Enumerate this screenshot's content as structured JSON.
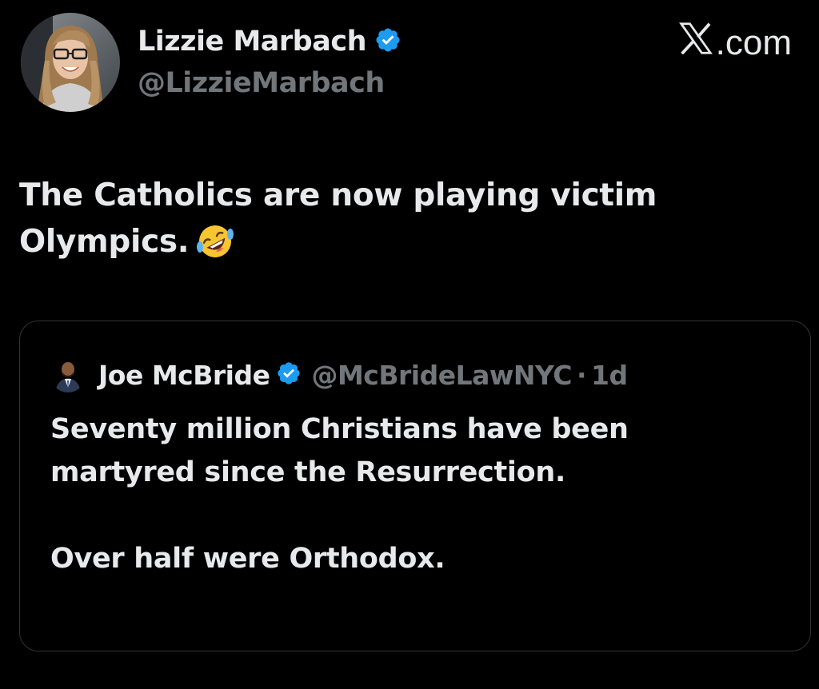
{
  "author": {
    "display_name": "Lizzie Marbach",
    "handle": "@LizzieMarbach",
    "verified_icon": "verified-badge-icon"
  },
  "brand": {
    "text": ".com",
    "logo_icon": "x-logo-icon"
  },
  "tweet": {
    "text": "The Catholics are now playing victim Olympics.",
    "emoji_icon": "rolling-on-floor-laughing-emoji-icon"
  },
  "quoted_tweet": {
    "display_name": "Joe McBride",
    "handle": "@McBrideLawNYC",
    "separator": "·",
    "timestamp": "1d",
    "paragraphs": [
      "Seventy million Christians have been martyred since the Resurrection.",
      "Over half were Orthodox."
    ]
  },
  "colors": {
    "background": "#000000",
    "primary_text": "#e7e9ea",
    "secondary_text": "#71767b",
    "verified_blue": "#1d9bf0",
    "card_border": "#2f3336"
  }
}
